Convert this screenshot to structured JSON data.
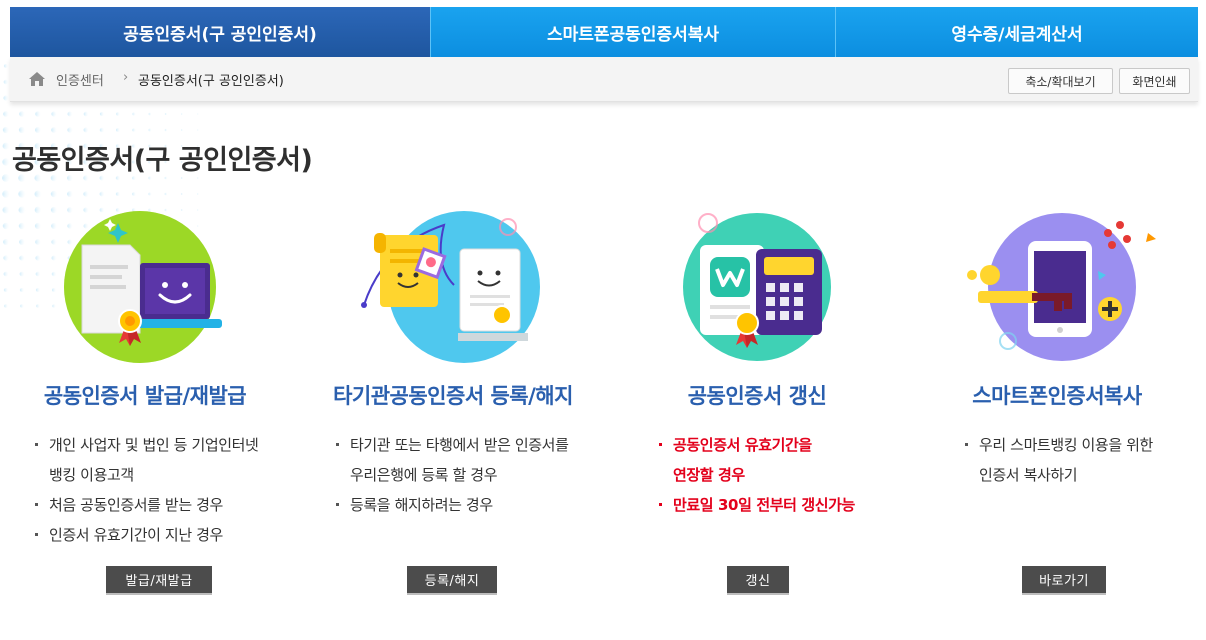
{
  "tabs": [
    {
      "label": "공동인증서(구 공인인증서)",
      "active": true
    },
    {
      "label": "스마트폰공동인증서복사",
      "active": false
    },
    {
      "label": "영수증/세금계산서",
      "active": false
    }
  ],
  "breadcrumb": {
    "home_icon": "home-icon",
    "items": [
      "인증센터",
      "공동인증서(구 공인인증서)"
    ],
    "separator": "›"
  },
  "tools": {
    "zoom_label": "축소/확대보기",
    "print_label": "화면인쇄"
  },
  "page_title": "공동인증서(구 공인인증서)",
  "cards": [
    {
      "title": "공동인증서 발급/재발급",
      "bullets": [
        [
          "개인 사업자 및 법인 등 기업인터넷",
          "뱅킹 이용고객"
        ],
        [
          "처음 공동인증서를 받는 경우"
        ],
        [
          "인증서 유효기간이 지난 경우"
        ]
      ],
      "button": "발급/재발급",
      "icon": "certificate-laptop-icon",
      "accent": "#8fd11b"
    },
    {
      "title": "타기관공동인증서 등록/해지",
      "bullets": [
        [
          "타기관 또는 타행에서 받은 인증서를",
          "우리은행에 등록 할 경우"
        ],
        [
          "등록을 해지하려는 경우"
        ]
      ],
      "button": "등록/해지",
      "icon": "certificate-scroll-icon",
      "accent": "#4fc8ee"
    },
    {
      "title": "공동인증서 갱신",
      "bullets": [
        [
          "공동인증서 유효기간을",
          "연장할 경우"
        ],
        [
          "만료일 30일 전부터 갱신가능"
        ]
      ],
      "button": "갱신",
      "icon": "certificate-calculator-icon",
      "accent": "#3fd1b5",
      "emphasis_color": "#e3001b"
    },
    {
      "title": "스마트폰인증서복사",
      "bullets": [
        [
          "우리 스마트뱅킹 이용을 위한",
          "인증서 복사하기"
        ]
      ],
      "button": "바로가기",
      "icon": "smartphone-key-icon",
      "accent": "#9b8ff0"
    }
  ],
  "colors": {
    "tab_active": "#2564b0",
    "tab_inactive": "#129be8",
    "card_title": "#2a5fae",
    "button_bg": "#4c4c4c"
  }
}
